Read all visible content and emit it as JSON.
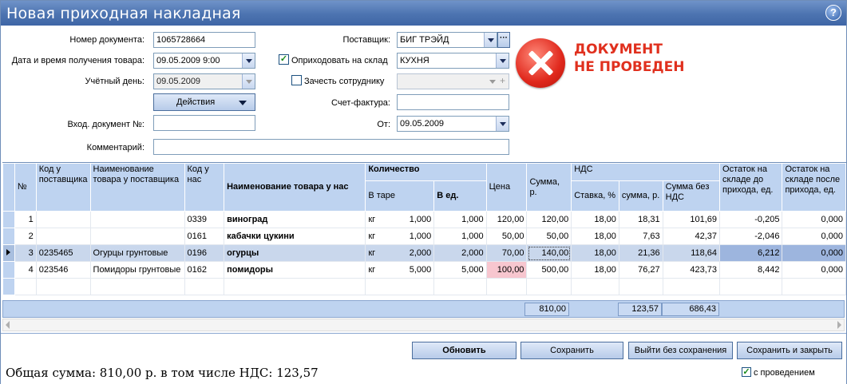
{
  "window": {
    "title": "Новая приходная накладная",
    "help": "?"
  },
  "form": {
    "doc_number_label": "Номер документа:",
    "doc_number": "1065728664",
    "datetime_label": "Дата и время получения товара:",
    "datetime": "09.05.2009 9:00",
    "account_day_label": "Учётный день:",
    "account_day": "09.05.2009",
    "actions_label": "Действия",
    "incoming_doc_label": "Вход. документ №:",
    "incoming_doc": "",
    "comment_label": "Комментарий:",
    "comment": "",
    "supplier_label": "Поставщик:",
    "supplier": "БИГ ТРЭЙД",
    "supplier_more": "···",
    "post_to_store_label": "Оприходовать на склад",
    "post_to_store_checked": true,
    "store": "КУХНЯ",
    "credit_employee_label": "Зачесть сотруднику",
    "credit_employee_checked": false,
    "employee": "",
    "invoice_label": "Счет-фактура:",
    "invoice": "",
    "from_label": "От:",
    "from_date": "09.05.2009"
  },
  "status": {
    "line1": "ДОКУМЕНТ",
    "line2": "НЕ ПРОВЕДЕН"
  },
  "table": {
    "headers": {
      "num": "№",
      "supplier_code": "Код у поставщика",
      "supplier_name": "Наименование товара у поставщика",
      "our_code": "Код у нас",
      "our_name": "Наименование товара у нас",
      "qty": "Количество",
      "qty_tare": "В таре",
      "qty_units": "В ед.",
      "price": "Цена",
      "sum": "Сумма, р.",
      "vat": "НДС",
      "vat_rate": "Ставка, %",
      "vat_sum": "сумма, р.",
      "sum_no_vat": "Сумма без НДС",
      "stock_before": "Остаток на складе до прихода, ед.",
      "stock_after": "Остаток на складе после прихода, ед."
    },
    "rows": [
      {
        "num": "1",
        "supplier_code": "",
        "supplier_name": "",
        "our_code": "0339",
        "our_name": "виноград",
        "unit": "кг",
        "tare": "1,000",
        "units": "1,000",
        "price": "120,00",
        "sum": "120,00",
        "vat_rate": "18,00",
        "vat_sum": "18,31",
        "sum_no_vat": "101,69",
        "stock_before": "-0,205",
        "stock_after": "0,000"
      },
      {
        "num": "2",
        "supplier_code": "",
        "supplier_name": "",
        "our_code": "0161",
        "our_name": "кабачки цукини",
        "unit": "кг",
        "tare": "1,000",
        "units": "1,000",
        "price": "50,00",
        "sum": "50,00",
        "vat_rate": "18,00",
        "vat_sum": "7,63",
        "sum_no_vat": "42,37",
        "stock_before": "-2,046",
        "stock_after": "0,000"
      },
      {
        "num": "3",
        "supplier_code": "0235465",
        "supplier_name": "Огурцы грунтовые",
        "our_code": "0196",
        "our_name": "огурцы",
        "unit": "кг",
        "tare": "2,000",
        "units": "2,000",
        "price": "70,00",
        "sum": "140,00",
        "vat_rate": "18,00",
        "vat_sum": "21,36",
        "sum_no_vat": "118,64",
        "stock_before": "6,212",
        "stock_after": "0,000"
      },
      {
        "num": "4",
        "supplier_code": "023546",
        "supplier_name": "Помидоры грунтовые",
        "our_code": "0162",
        "our_name": "помидоры",
        "unit": "кг",
        "tare": "5,000",
        "units": "5,000",
        "price": "100,00",
        "sum": "500,00",
        "vat_rate": "18,00",
        "vat_sum": "76,27",
        "sum_no_vat": "423,73",
        "stock_before": "8,442",
        "stock_after": "0,000"
      }
    ],
    "totals": {
      "sum": "810,00",
      "vat_sum": "123,57",
      "sum_no_vat": "686,43"
    }
  },
  "buttons": {
    "refresh": "Обновить",
    "save": "Сохранить",
    "exit_no_save": "Выйти без сохранения",
    "save_close": "Сохранить и закрыть"
  },
  "footer": {
    "total_text": "Общая сумма: 810,00 р. в том числе НДС: 123,57",
    "with_posting_label": "с проведением",
    "with_posting_checked": true
  },
  "icons": [
    "help-icon",
    "dropdown-arrow-icon",
    "error-x-icon",
    "checkbox-icon",
    "row-pointer-icon"
  ],
  "colors": {
    "title_bar": "#4c73b0",
    "header_bg": "#bed3f0",
    "status_red": "#e0301e",
    "selected_row": "#c9d7ec",
    "price_highlight": "#f7c6cf"
  }
}
